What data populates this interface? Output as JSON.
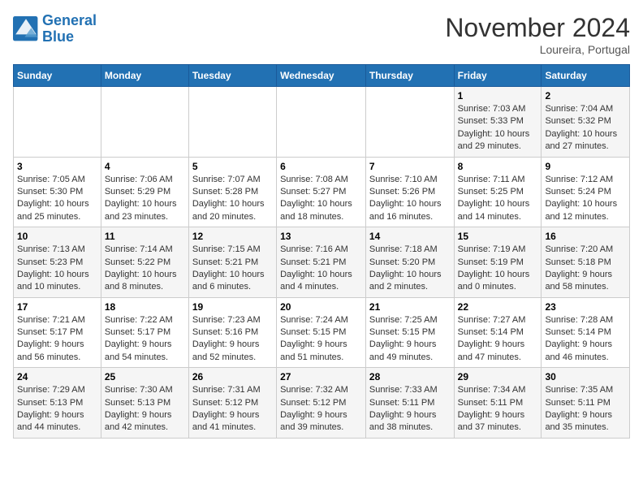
{
  "header": {
    "logo_line1": "General",
    "logo_line2": "Blue",
    "month": "November 2024",
    "location": "Loureira, Portugal"
  },
  "weekdays": [
    "Sunday",
    "Monday",
    "Tuesday",
    "Wednesday",
    "Thursday",
    "Friday",
    "Saturday"
  ],
  "weeks": [
    [
      {
        "day": "",
        "info": ""
      },
      {
        "day": "",
        "info": ""
      },
      {
        "day": "",
        "info": ""
      },
      {
        "day": "",
        "info": ""
      },
      {
        "day": "",
        "info": ""
      },
      {
        "day": "1",
        "info": "Sunrise: 7:03 AM\nSunset: 5:33 PM\nDaylight: 10 hours\nand 29 minutes."
      },
      {
        "day": "2",
        "info": "Sunrise: 7:04 AM\nSunset: 5:32 PM\nDaylight: 10 hours\nand 27 minutes."
      }
    ],
    [
      {
        "day": "3",
        "info": "Sunrise: 7:05 AM\nSunset: 5:30 PM\nDaylight: 10 hours\nand 25 minutes."
      },
      {
        "day": "4",
        "info": "Sunrise: 7:06 AM\nSunset: 5:29 PM\nDaylight: 10 hours\nand 23 minutes."
      },
      {
        "day": "5",
        "info": "Sunrise: 7:07 AM\nSunset: 5:28 PM\nDaylight: 10 hours\nand 20 minutes."
      },
      {
        "day": "6",
        "info": "Sunrise: 7:08 AM\nSunset: 5:27 PM\nDaylight: 10 hours\nand 18 minutes."
      },
      {
        "day": "7",
        "info": "Sunrise: 7:10 AM\nSunset: 5:26 PM\nDaylight: 10 hours\nand 16 minutes."
      },
      {
        "day": "8",
        "info": "Sunrise: 7:11 AM\nSunset: 5:25 PM\nDaylight: 10 hours\nand 14 minutes."
      },
      {
        "day": "9",
        "info": "Sunrise: 7:12 AM\nSunset: 5:24 PM\nDaylight: 10 hours\nand 12 minutes."
      }
    ],
    [
      {
        "day": "10",
        "info": "Sunrise: 7:13 AM\nSunset: 5:23 PM\nDaylight: 10 hours\nand 10 minutes."
      },
      {
        "day": "11",
        "info": "Sunrise: 7:14 AM\nSunset: 5:22 PM\nDaylight: 10 hours\nand 8 minutes."
      },
      {
        "day": "12",
        "info": "Sunrise: 7:15 AM\nSunset: 5:21 PM\nDaylight: 10 hours\nand 6 minutes."
      },
      {
        "day": "13",
        "info": "Sunrise: 7:16 AM\nSunset: 5:21 PM\nDaylight: 10 hours\nand 4 minutes."
      },
      {
        "day": "14",
        "info": "Sunrise: 7:18 AM\nSunset: 5:20 PM\nDaylight: 10 hours\nand 2 minutes."
      },
      {
        "day": "15",
        "info": "Sunrise: 7:19 AM\nSunset: 5:19 PM\nDaylight: 10 hours\nand 0 minutes."
      },
      {
        "day": "16",
        "info": "Sunrise: 7:20 AM\nSunset: 5:18 PM\nDaylight: 9 hours\nand 58 minutes."
      }
    ],
    [
      {
        "day": "17",
        "info": "Sunrise: 7:21 AM\nSunset: 5:17 PM\nDaylight: 9 hours\nand 56 minutes."
      },
      {
        "day": "18",
        "info": "Sunrise: 7:22 AM\nSunset: 5:17 PM\nDaylight: 9 hours\nand 54 minutes."
      },
      {
        "day": "19",
        "info": "Sunrise: 7:23 AM\nSunset: 5:16 PM\nDaylight: 9 hours\nand 52 minutes."
      },
      {
        "day": "20",
        "info": "Sunrise: 7:24 AM\nSunset: 5:15 PM\nDaylight: 9 hours\nand 51 minutes."
      },
      {
        "day": "21",
        "info": "Sunrise: 7:25 AM\nSunset: 5:15 PM\nDaylight: 9 hours\nand 49 minutes."
      },
      {
        "day": "22",
        "info": "Sunrise: 7:27 AM\nSunset: 5:14 PM\nDaylight: 9 hours\nand 47 minutes."
      },
      {
        "day": "23",
        "info": "Sunrise: 7:28 AM\nSunset: 5:14 PM\nDaylight: 9 hours\nand 46 minutes."
      }
    ],
    [
      {
        "day": "24",
        "info": "Sunrise: 7:29 AM\nSunset: 5:13 PM\nDaylight: 9 hours\nand 44 minutes."
      },
      {
        "day": "25",
        "info": "Sunrise: 7:30 AM\nSunset: 5:13 PM\nDaylight: 9 hours\nand 42 minutes."
      },
      {
        "day": "26",
        "info": "Sunrise: 7:31 AM\nSunset: 5:12 PM\nDaylight: 9 hours\nand 41 minutes."
      },
      {
        "day": "27",
        "info": "Sunrise: 7:32 AM\nSunset: 5:12 PM\nDaylight: 9 hours\nand 39 minutes."
      },
      {
        "day": "28",
        "info": "Sunrise: 7:33 AM\nSunset: 5:11 PM\nDaylight: 9 hours\nand 38 minutes."
      },
      {
        "day": "29",
        "info": "Sunrise: 7:34 AM\nSunset: 5:11 PM\nDaylight: 9 hours\nand 37 minutes."
      },
      {
        "day": "30",
        "info": "Sunrise: 7:35 AM\nSunset: 5:11 PM\nDaylight: 9 hours\nand 35 minutes."
      }
    ]
  ]
}
